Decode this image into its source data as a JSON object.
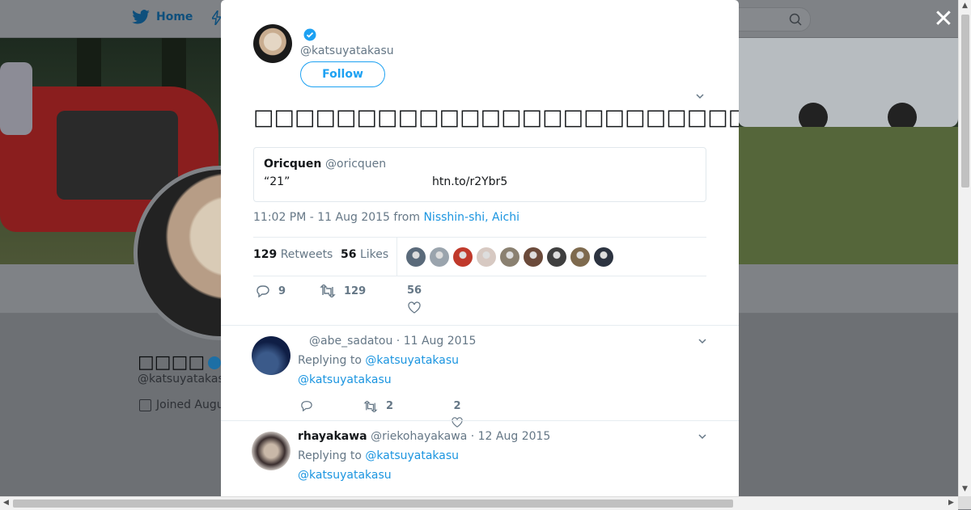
{
  "nav": {
    "home_label": "Home"
  },
  "profile": {
    "name": "□□□□",
    "handle": "@katsuyatakas",
    "joined": "Joined Augu"
  },
  "tweet": {
    "handle": "@katsuyatakasu",
    "follow_label": "Follow",
    "text": "□□□□□□□□□□□□□□□□□□□□□□□□□□□□□□□□□□□□□□□□□□□□□□□□□□□□",
    "quote": {
      "name": "Oricquen",
      "handle": "@oricquen",
      "text": "“21”",
      "link": "htn.to/r2Ybr5"
    },
    "time": "11:02 PM - 11 Aug 2015",
    "from_word": "from",
    "location": "Nisshin-shi, Aichi",
    "retweets_count": "129",
    "retweets_label": "Retweets",
    "likes_count": "56",
    "likes_label": "Likes",
    "likers": [
      "#5a6a7a",
      "#9aa4ad",
      "#c0392b",
      "#d7c9c2",
      "#8a8070",
      "#6b4a3a",
      "#3f3f3f",
      "#7e6a4e",
      "#2c3340"
    ],
    "reply_count": "9",
    "retweet_action_count": "129",
    "like_action_count": "56"
  },
  "replies": [
    {
      "name": "",
      "handle": "@abe_sadatou",
      "date": "11 Aug 2015",
      "replying_to_label": "Replying to",
      "replying_to": "@katsuyatakasu",
      "body": "@katsuyatakasu",
      "reply_count": "",
      "retweet_count": "2",
      "like_count": "2",
      "avatar_color": "#1b2a55"
    },
    {
      "name": "rhayakawa",
      "handle": "@riekohayakawa",
      "date": "12 Aug 2015",
      "replying_to_label": "Replying to",
      "replying_to": "@katsuyatakasu",
      "body": "@katsuyatakasu",
      "avatar_color": "#4a4040"
    }
  ],
  "colors": {
    "accent": "#1da1f2",
    "link": "#1b95e0",
    "muted": "#657786"
  }
}
